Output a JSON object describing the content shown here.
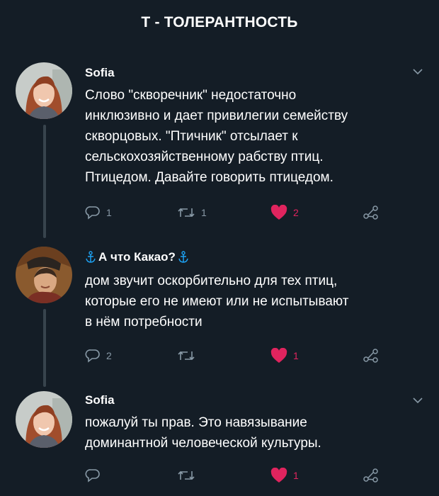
{
  "page_title": "Т - ТОЛЕРАНТНОСТЬ",
  "colors": {
    "background": "#141d26",
    "text": "#ffffff",
    "muted": "#8899a6",
    "like": "#e0245e",
    "thread": "#38444d",
    "anchor": "#1da1f2"
  },
  "tweets": [
    {
      "author": "Sofia",
      "text": "Слово \"скворечник\" недостаточно\nинклюзивно и дает привилегии семейству\nскворцовых. \"Птичник\" отсылает к\nсельскохозяйственному рабству птиц.\nПтицедом. Давайте говорить птицедом.",
      "replies": "1",
      "retweets": "1",
      "likes": "2",
      "icons": [
        "reply-icon",
        "retweet-icon",
        "heart-icon",
        "share-icon",
        "chevron-down-icon"
      ]
    },
    {
      "author": "А что Какао?",
      "author_icon": "anchor-icon",
      "text": "дом звучит оскорбительно для тех птиц,\nкоторые его не имеют или не испытывают\nв нём потребности",
      "replies": "2",
      "retweets": "",
      "likes": "1",
      "icons": [
        "reply-icon",
        "retweet-icon",
        "heart-icon",
        "share-icon"
      ]
    },
    {
      "author": "Sofia",
      "text": "пожалуй ты прав. Это навязывание\nдоминантной человеческой культуры.",
      "replies": "",
      "retweets": "",
      "likes": "1",
      "icons": [
        "reply-icon",
        "retweet-icon",
        "heart-icon",
        "share-icon",
        "chevron-down-icon"
      ]
    }
  ]
}
